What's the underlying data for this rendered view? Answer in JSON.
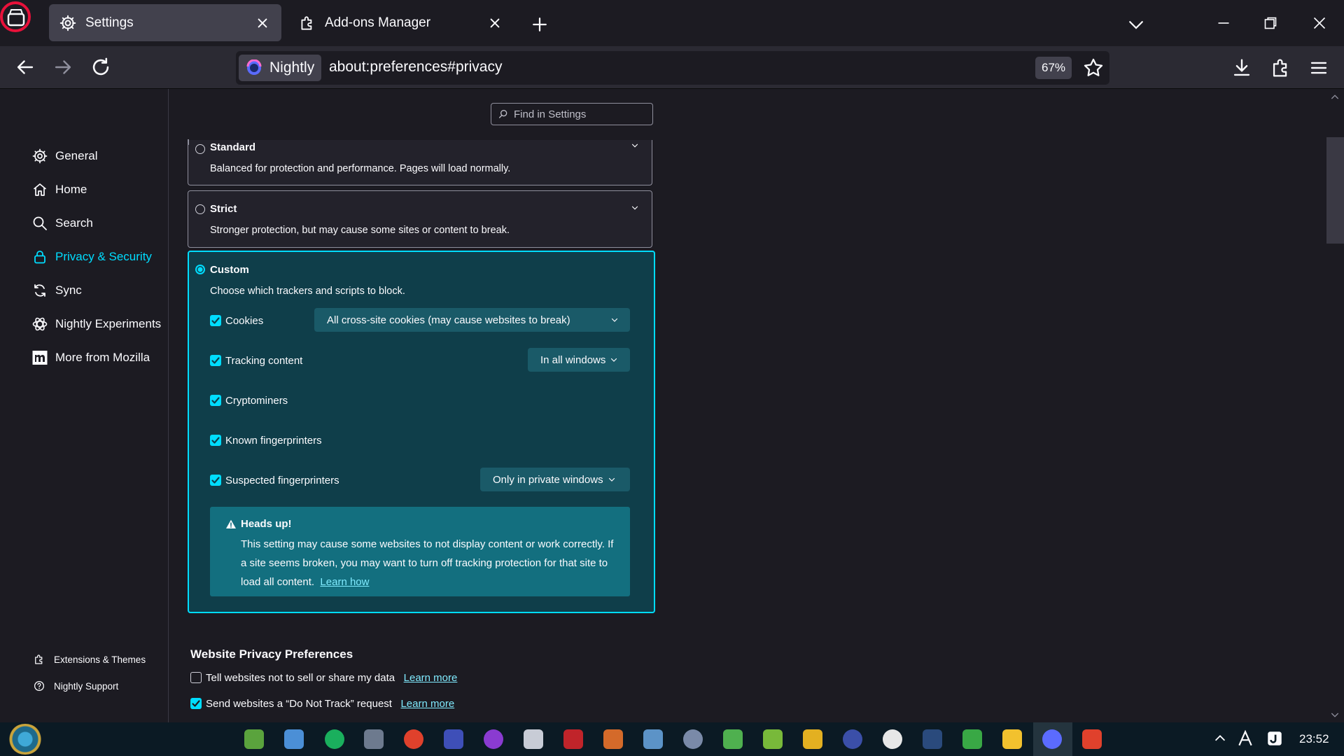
{
  "tabs": [
    {
      "title": "Settings",
      "active": true,
      "icon": "gear-icon"
    },
    {
      "title": "Add-ons Manager",
      "active": false,
      "icon": "puzzle-icon"
    }
  ],
  "navbar": {
    "identity_label": "Nightly",
    "url": "about:preferences#privacy",
    "zoom": "67%"
  },
  "sidebar": {
    "categories": [
      {
        "label": "General",
        "icon": "gear-icon"
      },
      {
        "label": "Home",
        "icon": "home-icon"
      },
      {
        "label": "Search",
        "icon": "search-icon"
      },
      {
        "label": "Privacy & Security",
        "icon": "lock-icon",
        "selected": true
      },
      {
        "label": "Sync",
        "icon": "sync-icon"
      },
      {
        "label": "Nightly Experiments",
        "icon": "flask-icon"
      },
      {
        "label": "More from Mozilla",
        "icon": "mozilla-icon"
      }
    ],
    "footer": [
      {
        "label": "Extensions & Themes",
        "icon": "puzzle-icon"
      },
      {
        "label": "Nightly Support",
        "icon": "help-icon"
      }
    ]
  },
  "search": {
    "placeholder": "Find in Settings"
  },
  "protection": {
    "standard": {
      "title": "Standard",
      "desc": "Balanced for protection and performance. Pages will load normally."
    },
    "strict": {
      "title": "Strict",
      "desc": "Stronger protection, but may cause some sites or content to break."
    },
    "custom": {
      "title": "Custom",
      "desc": "Choose which trackers and scripts to block.",
      "options": [
        {
          "label": "Cookies",
          "checked": true,
          "select": "All cross-site cookies (may cause websites to break)"
        },
        {
          "label": "Tracking content",
          "checked": true,
          "select": "In all windows"
        },
        {
          "label": "Cryptominers",
          "checked": true
        },
        {
          "label": "Known fingerprinters",
          "checked": true
        },
        {
          "label": "Suspected fingerprinters",
          "checked": true,
          "select": "Only in private windows"
        }
      ],
      "warning": {
        "title": "Heads up!",
        "body": "This setting may cause some websites to not display content or work correctly. If a site seems broken, you may want to turn off tracking protection for that site to load all content.",
        "link": "Learn how"
      }
    }
  },
  "website_privacy": {
    "title": "Website Privacy Preferences",
    "items": [
      {
        "label": "Tell websites not to sell or share my data",
        "checked": false,
        "link": "Learn more"
      },
      {
        "label": "Send websites a “Do Not Track” request",
        "checked": true,
        "link": "Learn more"
      }
    ]
  },
  "taskbar": {
    "clock": "23:52"
  },
  "colors": {
    "accent": "#00ddff",
    "custom_bg": "#0f3e4a",
    "warning_bg": "#136f7f",
    "tab_active": "#42414d"
  }
}
